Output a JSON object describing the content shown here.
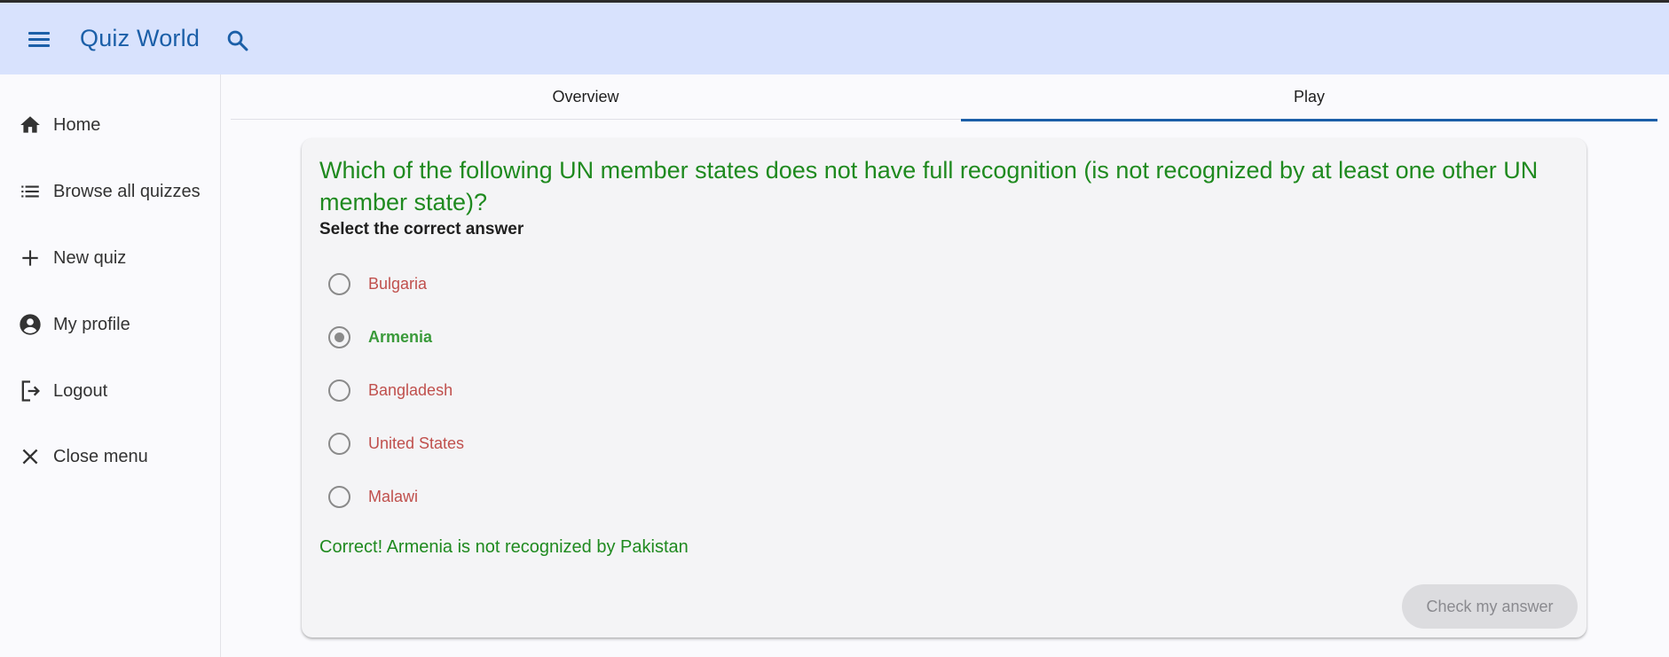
{
  "header": {
    "title": "Quiz World",
    "menu_icon": "hamburger-menu-icon",
    "search_icon": "search-icon",
    "background": "#d8e2fd",
    "accent": "#1b5fa8"
  },
  "sidebar": {
    "items": [
      {
        "label": "Home",
        "icon": "home-icon"
      },
      {
        "label": "Browse all quizzes",
        "icon": "list-icon"
      },
      {
        "label": "New quiz",
        "icon": "plus-icon"
      },
      {
        "label": "My profile",
        "icon": "account-circle-icon"
      },
      {
        "label": "Logout",
        "icon": "logout-icon"
      },
      {
        "label": "Close menu",
        "icon": "close-icon"
      }
    ]
  },
  "tabs": [
    {
      "label": "Overview",
      "active": false
    },
    {
      "label": "Play",
      "active": true
    }
  ],
  "quiz": {
    "question": "Which of the following UN member states does not have full recognition (is not recognized by at least one other UN member state)?",
    "instruction": "Select the correct answer",
    "options": [
      {
        "label": "Bulgaria",
        "selected": false,
        "correct": false
      },
      {
        "label": "Armenia",
        "selected": true,
        "correct": true
      },
      {
        "label": "Bangladesh",
        "selected": false,
        "correct": false
      },
      {
        "label": "United States",
        "selected": false,
        "correct": false
      },
      {
        "label": "Malawi",
        "selected": false,
        "correct": false
      }
    ],
    "feedback": "Correct! Armenia is not recognized by Pakistan",
    "check_button_label": "Check my answer",
    "correct_color": "#1f8a1f",
    "incorrect_color": "#c0504d"
  }
}
